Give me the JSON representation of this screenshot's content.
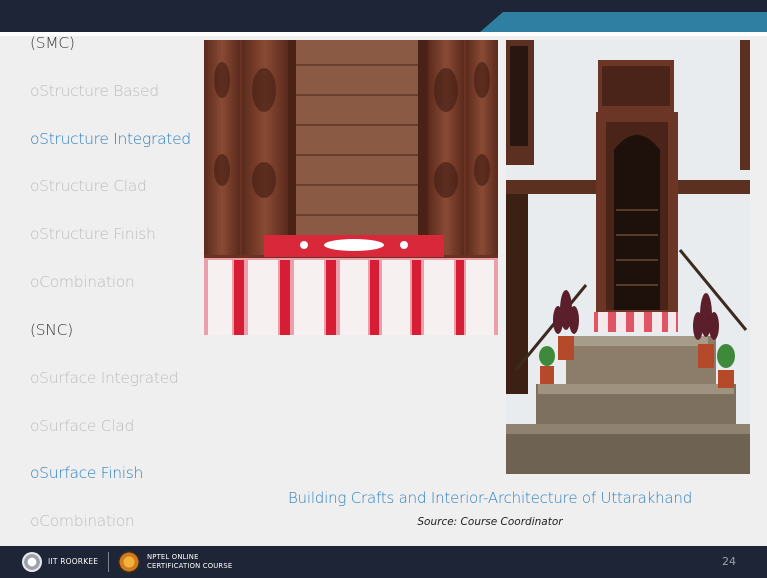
{
  "bullets": [
    {
      "text": "(SMC)",
      "tone": "dark"
    },
    {
      "text": "oStructure Based",
      "tone": "gray"
    },
    {
      "text": "oStructure Integrated",
      "tone": "blue"
    },
    {
      "text": "oStructure Clad",
      "tone": "gray"
    },
    {
      "text": "oStructure Finish",
      "tone": "gray"
    },
    {
      "text": "oCombination",
      "tone": "gray"
    },
    {
      "text": "(SNC)",
      "tone": "dark"
    },
    {
      "text": "oSurface Integrated",
      "tone": "gray"
    },
    {
      "text": "oSurface Clad",
      "tone": "gray"
    },
    {
      "text": "oSurface Finish",
      "tone": "blue"
    },
    {
      "text": "oCombination",
      "tone": "gray"
    }
  ],
  "caption": "Building Crafts and Interior-Architecture of Uttarakhand",
  "source": "Source: Course Coordinator",
  "footer": {
    "institute": "IIT ROORKEE",
    "nptel_line1": "NPTEL ONLINE",
    "nptel_line2": "CERTIFICATION COURSE",
    "page_number": "24"
  },
  "colors": {
    "band": "#1d2536",
    "accent": "#2e7fa1",
    "blue_text": "#2f80c0",
    "gray_text": "#bdbdbd"
  },
  "images": {
    "left": "carved wooden doorway with red-and-white textile on threshold",
    "right": "whitewashed house facade with carved wooden door, stone steps and potted plants"
  }
}
